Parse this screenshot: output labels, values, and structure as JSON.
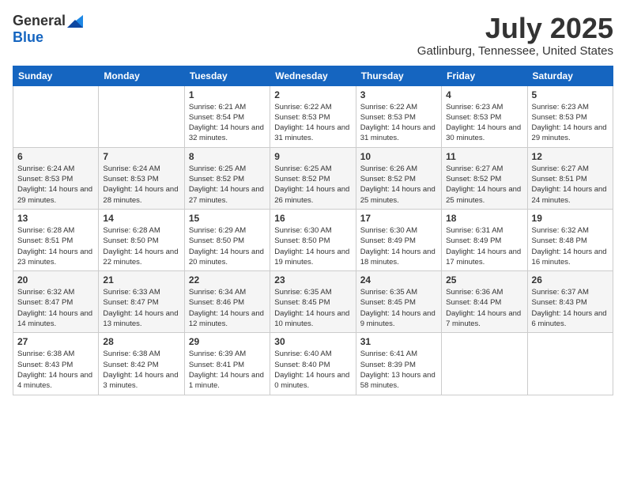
{
  "header": {
    "logo_general": "General",
    "logo_blue": "Blue",
    "month_title": "July 2025",
    "location": "Gatlinburg, Tennessee, United States"
  },
  "days_of_week": [
    "Sunday",
    "Monday",
    "Tuesday",
    "Wednesday",
    "Thursday",
    "Friday",
    "Saturday"
  ],
  "weeks": [
    [
      {
        "day": "",
        "info": ""
      },
      {
        "day": "",
        "info": ""
      },
      {
        "day": "1",
        "info": "Sunrise: 6:21 AM\nSunset: 8:54 PM\nDaylight: 14 hours and 32 minutes."
      },
      {
        "day": "2",
        "info": "Sunrise: 6:22 AM\nSunset: 8:53 PM\nDaylight: 14 hours and 31 minutes."
      },
      {
        "day": "3",
        "info": "Sunrise: 6:22 AM\nSunset: 8:53 PM\nDaylight: 14 hours and 31 minutes."
      },
      {
        "day": "4",
        "info": "Sunrise: 6:23 AM\nSunset: 8:53 PM\nDaylight: 14 hours and 30 minutes."
      },
      {
        "day": "5",
        "info": "Sunrise: 6:23 AM\nSunset: 8:53 PM\nDaylight: 14 hours and 29 minutes."
      }
    ],
    [
      {
        "day": "6",
        "info": "Sunrise: 6:24 AM\nSunset: 8:53 PM\nDaylight: 14 hours and 29 minutes."
      },
      {
        "day": "7",
        "info": "Sunrise: 6:24 AM\nSunset: 8:53 PM\nDaylight: 14 hours and 28 minutes."
      },
      {
        "day": "8",
        "info": "Sunrise: 6:25 AM\nSunset: 8:52 PM\nDaylight: 14 hours and 27 minutes."
      },
      {
        "day": "9",
        "info": "Sunrise: 6:25 AM\nSunset: 8:52 PM\nDaylight: 14 hours and 26 minutes."
      },
      {
        "day": "10",
        "info": "Sunrise: 6:26 AM\nSunset: 8:52 PM\nDaylight: 14 hours and 25 minutes."
      },
      {
        "day": "11",
        "info": "Sunrise: 6:27 AM\nSunset: 8:52 PM\nDaylight: 14 hours and 25 minutes."
      },
      {
        "day": "12",
        "info": "Sunrise: 6:27 AM\nSunset: 8:51 PM\nDaylight: 14 hours and 24 minutes."
      }
    ],
    [
      {
        "day": "13",
        "info": "Sunrise: 6:28 AM\nSunset: 8:51 PM\nDaylight: 14 hours and 23 minutes."
      },
      {
        "day": "14",
        "info": "Sunrise: 6:28 AM\nSunset: 8:50 PM\nDaylight: 14 hours and 22 minutes."
      },
      {
        "day": "15",
        "info": "Sunrise: 6:29 AM\nSunset: 8:50 PM\nDaylight: 14 hours and 20 minutes."
      },
      {
        "day": "16",
        "info": "Sunrise: 6:30 AM\nSunset: 8:50 PM\nDaylight: 14 hours and 19 minutes."
      },
      {
        "day": "17",
        "info": "Sunrise: 6:30 AM\nSunset: 8:49 PM\nDaylight: 14 hours and 18 minutes."
      },
      {
        "day": "18",
        "info": "Sunrise: 6:31 AM\nSunset: 8:49 PM\nDaylight: 14 hours and 17 minutes."
      },
      {
        "day": "19",
        "info": "Sunrise: 6:32 AM\nSunset: 8:48 PM\nDaylight: 14 hours and 16 minutes."
      }
    ],
    [
      {
        "day": "20",
        "info": "Sunrise: 6:32 AM\nSunset: 8:47 PM\nDaylight: 14 hours and 14 minutes."
      },
      {
        "day": "21",
        "info": "Sunrise: 6:33 AM\nSunset: 8:47 PM\nDaylight: 14 hours and 13 minutes."
      },
      {
        "day": "22",
        "info": "Sunrise: 6:34 AM\nSunset: 8:46 PM\nDaylight: 14 hours and 12 minutes."
      },
      {
        "day": "23",
        "info": "Sunrise: 6:35 AM\nSunset: 8:45 PM\nDaylight: 14 hours and 10 minutes."
      },
      {
        "day": "24",
        "info": "Sunrise: 6:35 AM\nSunset: 8:45 PM\nDaylight: 14 hours and 9 minutes."
      },
      {
        "day": "25",
        "info": "Sunrise: 6:36 AM\nSunset: 8:44 PM\nDaylight: 14 hours and 7 minutes."
      },
      {
        "day": "26",
        "info": "Sunrise: 6:37 AM\nSunset: 8:43 PM\nDaylight: 14 hours and 6 minutes."
      }
    ],
    [
      {
        "day": "27",
        "info": "Sunrise: 6:38 AM\nSunset: 8:43 PM\nDaylight: 14 hours and 4 minutes."
      },
      {
        "day": "28",
        "info": "Sunrise: 6:38 AM\nSunset: 8:42 PM\nDaylight: 14 hours and 3 minutes."
      },
      {
        "day": "29",
        "info": "Sunrise: 6:39 AM\nSunset: 8:41 PM\nDaylight: 14 hours and 1 minute."
      },
      {
        "day": "30",
        "info": "Sunrise: 6:40 AM\nSunset: 8:40 PM\nDaylight: 14 hours and 0 minutes."
      },
      {
        "day": "31",
        "info": "Sunrise: 6:41 AM\nSunset: 8:39 PM\nDaylight: 13 hours and 58 minutes."
      },
      {
        "day": "",
        "info": ""
      },
      {
        "day": "",
        "info": ""
      }
    ]
  ]
}
